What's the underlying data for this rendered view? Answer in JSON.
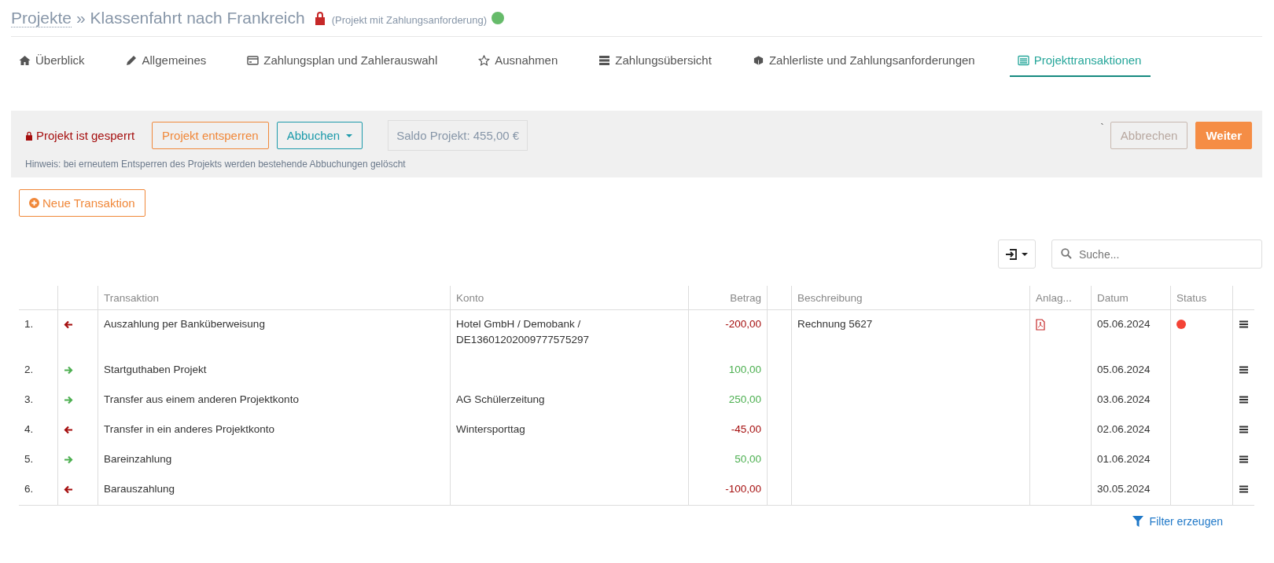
{
  "header": {
    "breadcrumb_link": "Projekte",
    "separator": "»",
    "title": "Klassenfahrt nach Frankreich",
    "locked": true,
    "subtitle": "(Projekt mit Zahlungsanforderung)",
    "payment_request_active": true
  },
  "tabs": [
    {
      "label": "Überblick",
      "selected": false
    },
    {
      "label": "Allgemeines",
      "selected": false
    },
    {
      "label": "Zahlungsplan und Zahlerauswahl",
      "selected": false
    },
    {
      "label": "Ausnahmen",
      "selected": false
    },
    {
      "label": "Zahlungsübersicht",
      "selected": false
    },
    {
      "label": "Zahlerliste und Zahlungsanforderungen",
      "selected": false
    },
    {
      "label": "Projekttransaktionen",
      "selected": true
    }
  ],
  "lock_panel": {
    "status": "Projekt ist gesperrt",
    "unlock_button": "Projekt entsperren",
    "book_button": "Abbuchen",
    "balance": "Saldo Projekt: 455,00 €",
    "hint": "Hinweis: bei erneutem Entsperren des Projekts werden bestehende Abbuchungen gelöscht",
    "stray_mark": "`",
    "cancel_button": {
      "label": "Abbrechen",
      "disabled": true
    },
    "next_button": {
      "label": "Weiter",
      "disabled": false
    }
  },
  "new_transaction_button": "Neue Transaktion",
  "search": {
    "placeholder": "Suche..."
  },
  "table": {
    "columns": [
      "Transaktion",
      "Konto",
      "Betrag",
      "Beschreibung",
      "Anlag...",
      "Datum",
      "Status"
    ],
    "rows": [
      {
        "number": "1.",
        "incoming": false,
        "transaction": "Auszahlung per Banküberweisung",
        "account": "Hotel GmbH / Demobank / DE13601202009777575297",
        "amount": "-200,00",
        "description": "Rechnung 5627",
        "attachment": true,
        "date": "05.06.2024",
        "color": "#f44336"
      },
      {
        "number": "2.",
        "incoming": true,
        "transaction": "Startguthaben Projekt",
        "amount": "100,00",
        "attachment": false,
        "date": "05.06.2024"
      },
      {
        "number": "3.",
        "incoming": true,
        "transaction": "Transfer aus einem anderen Projektkonto",
        "account": "AG Schülerzeitung",
        "amount": "250,00",
        "attachment": false,
        "date": "03.06.2024"
      },
      {
        "number": "4.",
        "incoming": false,
        "transaction": "Transfer in ein anderes Projektkonto",
        "account": "Wintersporttag",
        "amount": "-45,00",
        "attachment": false,
        "date": "02.06.2024"
      },
      {
        "number": "5.",
        "incoming": true,
        "transaction": "Bareinzahlung",
        "amount": "50,00",
        "attachment": false,
        "date": "01.06.2024"
      },
      {
        "number": "6.",
        "incoming": false,
        "transaction": "Barauszahlung",
        "amount": "-100,00",
        "attachment": false,
        "date": "30.05.2024"
      }
    ]
  },
  "filter_link": "Filter erzeugen"
}
